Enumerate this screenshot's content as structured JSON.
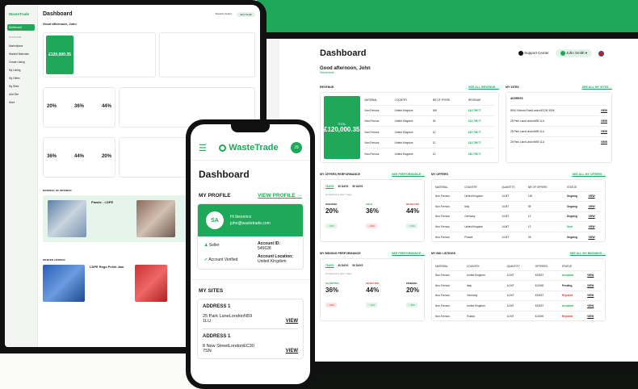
{
  "brand": {
    "name": "WasteTrade"
  },
  "dashboard": {
    "title": "Dashboard",
    "greeting": "Good afternoon, John",
    "role": "Wastetrade",
    "support": "Support Center",
    "user": "John Smith",
    "user_short": "John Smith"
  },
  "revenue": {
    "title": "REVENUE",
    "see_all": "SEE ALL REVENUE →",
    "total_label": "TOTAL",
    "total": "£120,000.35",
    "headers": [
      "MATERIAL",
      "COUNTRY",
      "NR OF FFERS",
      "REVENUE"
    ],
    "rows": [
      [
        "Non-Ferrous",
        "United Kingdom",
        "160",
        "£12,799.77"
      ],
      [
        "Non-Ferrous",
        "United Kingdom",
        "26",
        "£12,799.77"
      ],
      [
        "Non-Ferrous",
        "United Kingdom",
        "12",
        "£27,799.77"
      ],
      [
        "Non-Ferrous",
        "United Kingdom",
        "12",
        "£12,799.77"
      ],
      [
        "Non-Ferrous",
        "United Kingdom",
        "13",
        "£92,799.77"
      ]
    ]
  },
  "sites": {
    "title": "MY SITES",
    "see_all": "SEE ALL MY SITES →",
    "header": "ADDRESS",
    "view": "VIEW",
    "items": [
      "8910 Victoria RoadLondonEC2N 3GW",
      "25 Park LaneLondonN59 1LU",
      "25 Park LaneLondonN59 1LU",
      "25 Park LaneLondonN59 1LU"
    ]
  },
  "offers_perf": {
    "title": "MY OFFERS PERFORMANCE",
    "see": "SEE PERFORMANCE →",
    "tabs": [
      "7DAYS",
      "30 DAYS",
      "90 DAYS"
    ],
    "compared": "Compared to last 7 days",
    "stats": [
      {
        "label": "ONGOING",
        "value": "20%",
        "delta": "↑ 35%"
      },
      {
        "label": "SOLD",
        "value": "36%",
        "delta": "↓ 30%"
      },
      {
        "label": "REJECTED",
        "value": "44%",
        "delta": "↑ 30%"
      }
    ]
  },
  "offers": {
    "title": "MY OFFERS",
    "see_all": "SEE ALL MY OFFERS →",
    "headers": [
      "MATERIAL",
      "COUNTRY",
      "QUANTITY",
      "NR OF OFFERS",
      "STATUS"
    ],
    "rows": [
      [
        "Non-Ferrous",
        "United Kingdom",
        "14.MT",
        "130",
        "Ongoing"
      ],
      [
        "Non-Ferrous",
        "Italy",
        "14.MT",
        "59",
        "Ongoing"
      ],
      [
        "Non-Ferrous",
        "Germany",
        "14.MT",
        "12",
        "Ongoing"
      ],
      [
        "Non-Ferrous",
        "United Kingdom",
        "14.MT",
        "12",
        "Sold"
      ],
      [
        "Non-Ferrous",
        "Poland",
        "14.MT",
        "26",
        "Ongoing"
      ]
    ]
  },
  "bidding_perf": {
    "title": "MY BIDDING PERFORMANCE",
    "see": "SEE PERFORMANCE →",
    "tabs": [
      "7DAYS",
      "30 DAYS",
      "90 DAYS"
    ],
    "compared": "Compared to last 7 days",
    "stats": [
      {
        "label": "ACCEPTED",
        "value": "36%",
        "delta": "↓ 35%"
      },
      {
        "label": "REJECTED",
        "value": "44%",
        "delta": "↑ 30%"
      },
      {
        "label": "PENDING",
        "value": "20%",
        "delta": "↑ 35%"
      }
    ]
  },
  "bids": {
    "title": "MY BID LISTINGS",
    "see_all": "SEE ALL MY BIDDINGS →",
    "headers": [
      "MATERIAL",
      "COUNTRY",
      "QUANTITY",
      "OFFERED",
      "STATUS"
    ],
    "rows": [
      [
        "Non-Ferrous",
        "United Kingdom",
        "14.MT",
        "£33527",
        "Accepted"
      ],
      [
        "Non-Ferrous",
        "Italy",
        "14.MT",
        "£10000",
        "Pending"
      ],
      [
        "Non-Ferrous",
        "Germany",
        "14.MT",
        "£33527",
        "Rejected"
      ],
      [
        "Non-Ferrous",
        "United Kingdom",
        "14.MT",
        "£33527",
        "Accepted"
      ],
      [
        "Non-Ferrous",
        "Poland",
        "14.MT",
        "£10000",
        "Rejected"
      ]
    ]
  },
  "sidebar": {
    "items": [
      "Dashboard",
      "PLATFORM",
      "Marketplace",
      "Wanted Materials",
      "Create Listing",
      "My Listing",
      "My Offers",
      "My Sites",
      "Add Site",
      "More"
    ]
  },
  "tablet": {
    "material_of_interest": "MATERIAL OF INTEREST",
    "listing_title": "Plastic - LDPE",
    "wanted_listings": "WANTED LISTINGS",
    "wanted_title": "LDPE Regs Pellet Jam",
    "badge": "Available Now",
    "badge2": "Material Required"
  },
  "phone": {
    "title": "Dashboard",
    "profile": "MY PROFILE",
    "view_profile": "VIEW PROFILE →",
    "initials": "SA",
    "hi": "Hi Ibezerics",
    "email": "john@wastetrade.com",
    "seller": "Seller",
    "account_id_label": "Account ID:",
    "account_id": "545628",
    "verified": "Account Verified",
    "location_label": "Account Location:",
    "location": "United Kingdom",
    "my_sites": "MY SITES",
    "addresses": [
      {
        "label": "ADDRESS 1",
        "text": "25 Park LaneLondonN59 1LU",
        "view": "VIEW"
      },
      {
        "label": "ADDRESS 1",
        "text": "8 New StreetLondonEC30 7SN",
        "view": "VIEW"
      }
    ],
    "avatar": "JS"
  }
}
